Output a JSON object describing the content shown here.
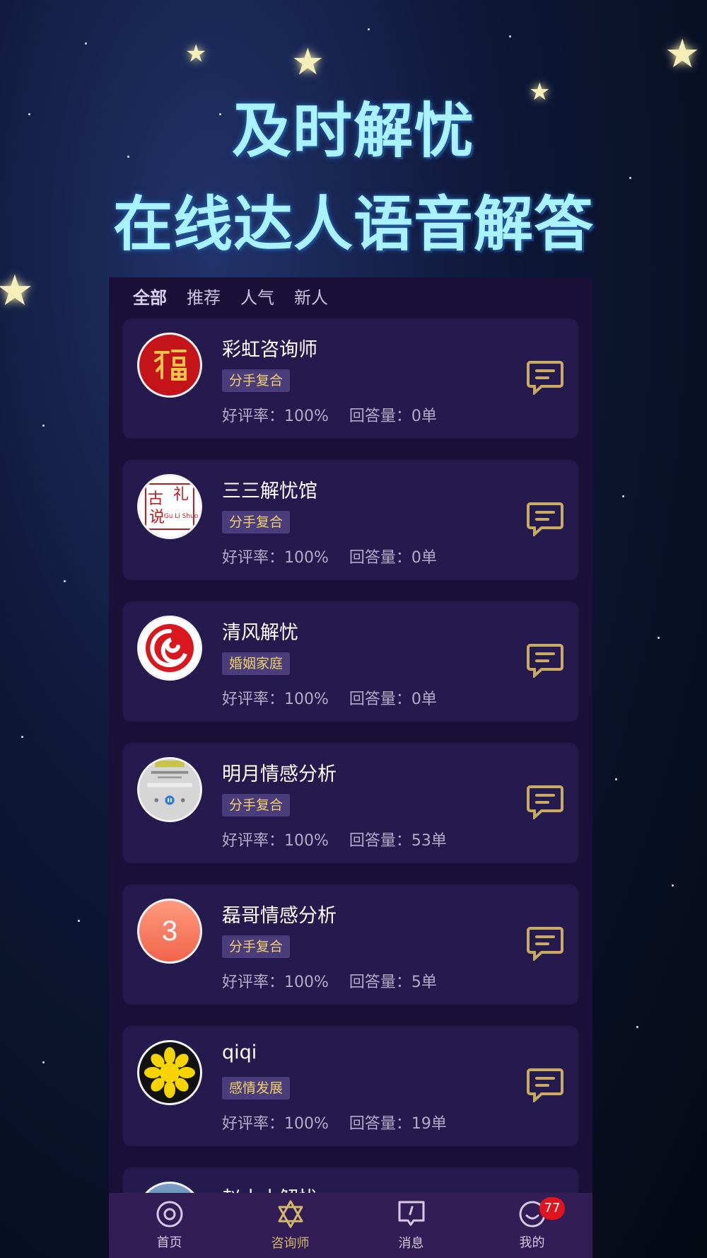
{
  "headline": {
    "line1": "及时解忧",
    "line2": "在线达人语音解答"
  },
  "tabs": [
    {
      "label": "全部",
      "active": true
    },
    {
      "label": "推荐",
      "active": false
    },
    {
      "label": "人气",
      "active": false
    },
    {
      "label": "新人",
      "active": false
    }
  ],
  "consultants": [
    {
      "name": "彩虹咨询师",
      "tag": "分手复合",
      "rating": "好评率：100%",
      "answers": "回答量：0单",
      "avatar": "fu-avatar"
    },
    {
      "name": "三三解忧馆",
      "tag": "分手复合",
      "rating": "好评率：100%",
      "answers": "回答量：0单",
      "avatar": "seal-avatar",
      "avatar_text": [
        "古",
        "礼",
        "说",
        "Gu Li Shuo"
      ]
    },
    {
      "name": "清风解忧",
      "tag": "婚姻家庭",
      "rating": "好评率：100%",
      "answers": "回答量：0单",
      "avatar": "swirl-avatar"
    },
    {
      "name": "明月情感分析",
      "tag": "分手复合",
      "rating": "好评率：100%",
      "answers": "回答量：53单",
      "avatar": "screenshot-avatar"
    },
    {
      "name": "磊哥情感分析",
      "tag": "分手复合",
      "rating": "好评率：100%",
      "answers": "回答量：5单",
      "avatar": "number-avatar",
      "avatar_text": "3"
    },
    {
      "name": "qiqi",
      "tag": "感情发展",
      "rating": "好评率：100%",
      "answers": "回答量：19单",
      "avatar": "flower-avatar"
    },
    {
      "name": "赵小小解忧",
      "avatar": "photo-avatar"
    }
  ],
  "nav": {
    "home": "首页",
    "consultant": "咨询师",
    "messages": "消息",
    "mine": "我的",
    "badge_count": "77"
  },
  "colors": {
    "accent": "#d4b86a",
    "tag_text": "#f1d06a",
    "badge": "#e0141e",
    "card_bg": "#241a4d"
  }
}
